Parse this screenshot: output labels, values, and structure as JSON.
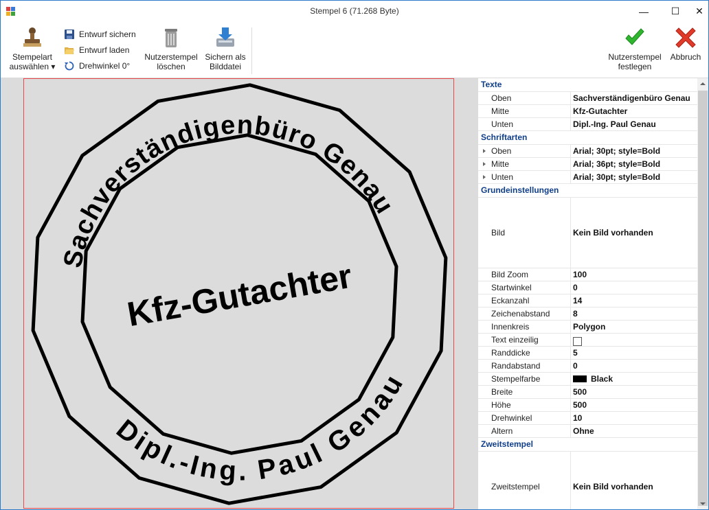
{
  "window": {
    "title": "Stempel 6 (71.268 Byte)",
    "minimize": "—",
    "maximize": "☐",
    "close": "✕"
  },
  "ribbon": {
    "stempelart": {
      "line1": "Stempelart",
      "line2": "auswählen ▾"
    },
    "entwurf_sichern": "Entwurf sichern",
    "entwurf_laden": "Entwurf laden",
    "drehwinkel": "Drehwinkel 0°",
    "nutzerstempel_loeschen": {
      "line1": "Nutzerstempel",
      "line2": "löschen"
    },
    "sichern_bilddatei": {
      "line1": "Sichern als",
      "line2": "Bilddatei"
    },
    "nutzerstempel_festlegen": {
      "line1": "Nutzerstempel",
      "line2": "festlegen"
    },
    "abbruch": "Abbruch"
  },
  "stamp": {
    "top_text": "Sachverständigenbüro Genau",
    "middle_text": "Kfz-Gutachter",
    "bottom_text": "Dipl.-Ing. Paul Genau",
    "corners": 14,
    "rotation_deg": 10,
    "stamp_color": "#000000"
  },
  "properties": {
    "texte": {
      "label": "Texte",
      "oben": {
        "key": "Oben",
        "value": "Sachverständigenbüro Genau"
      },
      "mitte": {
        "key": "Mitte",
        "value": "Kfz-Gutachter"
      },
      "unten": {
        "key": "Unten",
        "value": "Dipl.-Ing. Paul Genau"
      }
    },
    "schriftarten": {
      "label": "Schriftarten",
      "oben": {
        "key": "Oben",
        "value": "Arial; 30pt; style=Bold"
      },
      "mitte": {
        "key": "Mitte",
        "value": "Arial; 36pt; style=Bold"
      },
      "unten": {
        "key": "Unten",
        "value": "Arial; 30pt; style=Bold"
      }
    },
    "grundeinstellungen": {
      "label": "Grundeinstellungen",
      "bild": {
        "key": "Bild",
        "value": "Kein Bild vorhanden"
      },
      "bild_zoom": {
        "key": "Bild Zoom",
        "value": "100"
      },
      "startwinkel": {
        "key": "Startwinkel",
        "value": "0"
      },
      "eckanzahl": {
        "key": "Eckanzahl",
        "value": "14"
      },
      "zeichenabstand": {
        "key": "Zeichenabstand",
        "value": "8"
      },
      "innenkreis": {
        "key": "Innenkreis",
        "value": "Polygon"
      },
      "text_einzeilig": {
        "key": "Text einzeilig"
      },
      "randdicke": {
        "key": "Randdicke",
        "value": "5"
      },
      "randabstand": {
        "key": "Randabstand",
        "value": "0"
      },
      "stempelfarbe": {
        "key": "Stempelfarbe",
        "value": "Black"
      },
      "breite": {
        "key": "Breite",
        "value": "500"
      },
      "hoehe": {
        "key": "Höhe",
        "value": "500"
      },
      "drehwinkel": {
        "key": "Drehwinkel",
        "value": "10"
      },
      "altern": {
        "key": "Altern",
        "value": "Ohne"
      }
    },
    "zweitstempel": {
      "label": "Zweitstempel",
      "zweitstempel": {
        "key": "Zweitstempel",
        "value": "Kein Bild vorhanden"
      }
    }
  }
}
